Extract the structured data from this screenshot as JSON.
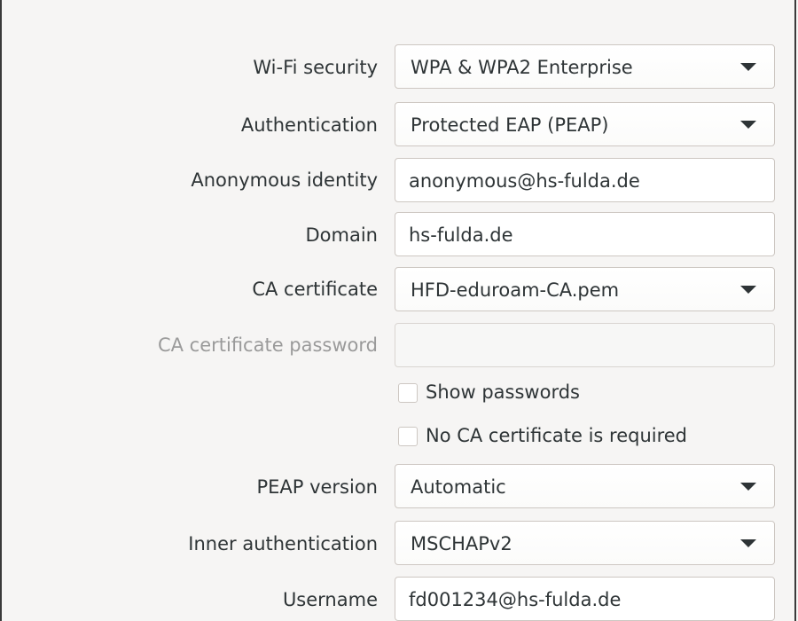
{
  "form": {
    "wifi_security": {
      "label": "Wi-Fi security",
      "value": "WPA & WPA2 Enterprise"
    },
    "authentication": {
      "label": "Authentication",
      "value": "Protected EAP (PEAP)"
    },
    "anonymous_identity": {
      "label": "Anonymous identity",
      "value": "anonymous@hs-fulda.de"
    },
    "domain": {
      "label": "Domain",
      "value": "hs-fulda.de"
    },
    "ca_certificate": {
      "label": "CA certificate",
      "value": "HFD-eduroam-CA.pem"
    },
    "ca_certificate_password": {
      "label": "CA certificate password",
      "value": ""
    },
    "show_passwords": {
      "label": "Show passwords",
      "checked": false
    },
    "no_ca_required": {
      "label": "No CA certificate is required",
      "checked": false
    },
    "peap_version": {
      "label": "PEAP version",
      "value": "Automatic"
    },
    "inner_authentication": {
      "label": "Inner authentication",
      "value": "MSCHAPv2"
    },
    "username": {
      "label": "Username",
      "value": "fd001234@hs-fulda.de"
    }
  },
  "icons": {
    "dropdown": "chevron-down-icon",
    "checkbox": "checkbox-unchecked"
  },
  "colors": {
    "background": "#f6f5f4",
    "text": "#2e3436",
    "disabled_text": "#9a9a9a",
    "border": "#cdc7c2"
  }
}
